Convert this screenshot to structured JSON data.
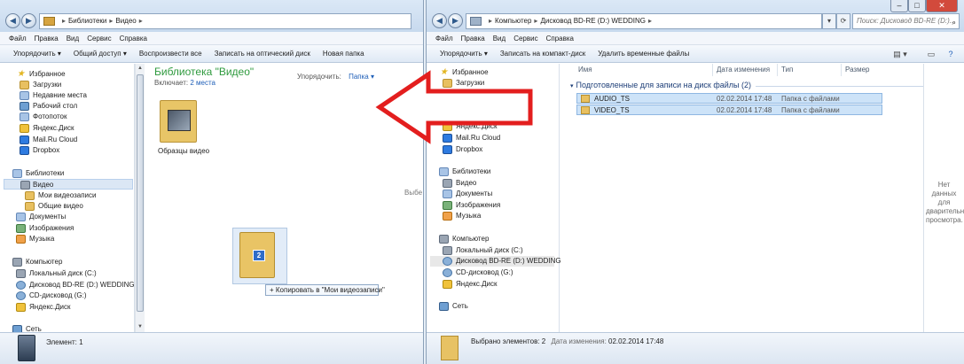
{
  "left_window": {
    "breadcrumb": [
      "Библиотеки",
      "Видео"
    ],
    "menu": [
      "Файл",
      "Правка",
      "Вид",
      "Сервис",
      "Справка"
    ],
    "toolbar": [
      "Упорядочить ▾",
      "Общий доступ ▾",
      "Воспроизвести все",
      "Записать на оптический диск",
      "Новая папка"
    ],
    "library_title": "Библиотека \"Видео\"",
    "includes_label": "Включает:",
    "includes_link": "2 места",
    "arrange_label": "Упорядочить:",
    "arrange_value": "Папка ▾",
    "folder_label": "Образцы видео",
    "nav": {
      "favorites": "Избранное",
      "fav_items": [
        "Загрузки",
        "Недавние места",
        "Рабочий стол",
        "Фотопоток",
        "Яндекс.Диск",
        "Mail.Ru Cloud",
        "Dropbox"
      ],
      "libraries": "Библиотеки",
      "video": "Видео",
      "video_items": [
        "Мои видеозаписи",
        "Общие видео"
      ],
      "lib_items": [
        "Документы",
        "Изображения",
        "Музыка"
      ],
      "computer": "Компьютер",
      "drives": [
        "Локальный диск (C:)",
        "Дисковод BD-RE (D:) WEDDING",
        "CD-дисковод (G:)",
        "Яндекс.Диск"
      ],
      "network": "Сеть"
    },
    "drag_badge": "2",
    "drag_tip": "+ Копировать в \"Мои видеозаписи\"",
    "status": "Элемент: 1",
    "partial_text": "Выбе"
  },
  "right_window": {
    "breadcrumb": [
      "Компьютер",
      "Дисковод BD-RE (D:) WEDDING"
    ],
    "search_placeholder": "Поиск: Дисковод BD-RE (D:)...",
    "menu": [
      "Файл",
      "Правка",
      "Вид",
      "Сервис",
      "Справка"
    ],
    "toolbar": [
      "Упорядочить ▾",
      "Записать на компакт-диск",
      "Удалить временные файлы"
    ],
    "columns": [
      "Имя",
      "Дата изменения",
      "Тип",
      "Размер"
    ],
    "group_header": "Подготовленные для записи на диск файлы (2)",
    "files": [
      {
        "name": "AUDIO_TS",
        "date": "02.02.2014 17:48",
        "type": "Папка с файлами"
      },
      {
        "name": "VIDEO_TS",
        "date": "02.02.2014 17:48",
        "type": "Папка с файлами"
      }
    ],
    "nav": {
      "favorites": "Избранное",
      "fav_items": [
        "Загрузки",
        "Яндекс.Диск",
        "Mail.Ru Cloud",
        "Dropbox"
      ],
      "libraries": "Библиотеки",
      "lib_items": [
        "Видео",
        "Документы",
        "Изображения",
        "Музыка"
      ],
      "computer": "Компьютер",
      "drives": [
        "Локальный диск (C:)",
        "Дисковод BD-RE (D:) WEDDING",
        "CD-дисковод (G:)",
        "Яндекс.Диск"
      ],
      "network": "Сеть"
    },
    "preview_text": "Нет данных для дварительн просмотра.",
    "status_selected": "Выбрано элементов: 2",
    "status_date_label": "Дата изменения:",
    "status_date": "02.02.2014 17:48"
  },
  "colors": {
    "arrow": "#e31e1e",
    "library_title": "#2f9a3e",
    "selection": "#cde3f8"
  }
}
